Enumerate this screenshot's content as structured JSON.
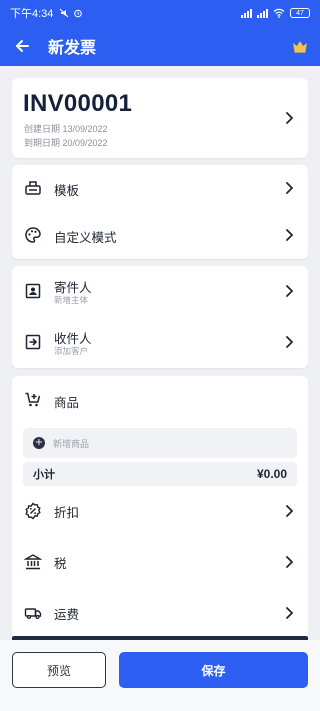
{
  "status_bar": {
    "time": "下午4:34",
    "battery": "47"
  },
  "app_bar": {
    "title": "新发票"
  },
  "invoice": {
    "number": "INV00001",
    "created": "创建日期 13/09/2022",
    "due": "到期日期 20/09/2022"
  },
  "settings": {
    "template_label": "模板",
    "custom_label": "自定义模式"
  },
  "parties": {
    "sender_label": "寄件人",
    "sender_sub": "新增主体",
    "recipient_label": "收件人",
    "recipient_sub": "添加客户"
  },
  "items": {
    "title": "商品",
    "add_label": "新增商品",
    "subtotal_label": "小计",
    "subtotal_value": "¥0.00",
    "discount_label": "折扣",
    "tax_label": "税",
    "shipping_label": "运费"
  },
  "actions": {
    "preview_label": "预览",
    "save_label": "保存"
  },
  "colors": {
    "primary": "#2c5ff1",
    "background": "#eef0f4",
    "card": "#ffffff",
    "dark": "#1f2a44"
  },
  "icons": [
    "back-arrow-icon",
    "crown-icon",
    "template-icon",
    "palette-icon",
    "contact-card-icon",
    "login-icon",
    "add-cart-icon",
    "plus-icon",
    "discount-icon",
    "bank-icon",
    "truck-icon",
    "chevron-right-icon"
  ]
}
